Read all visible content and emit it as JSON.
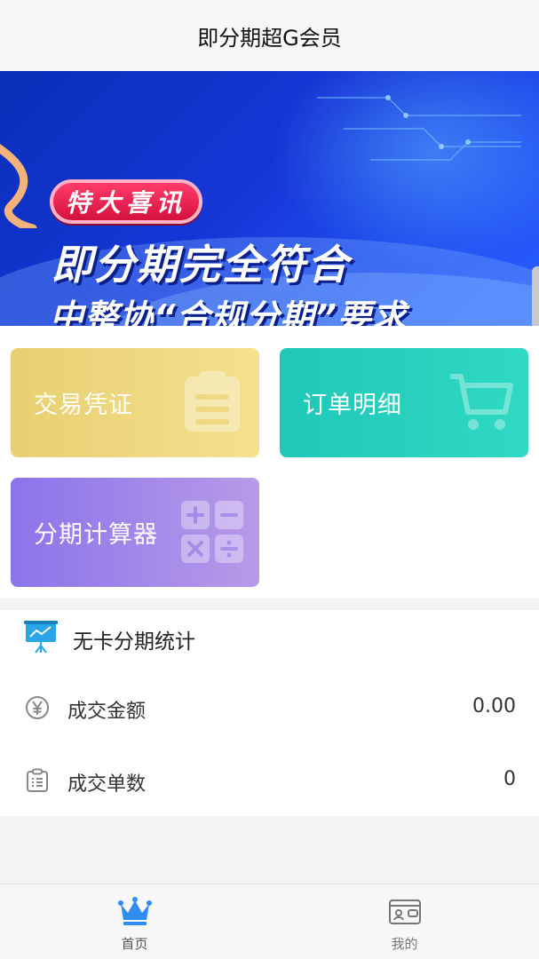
{
  "header": {
    "title": "即分期超G会员"
  },
  "banner": {
    "badge": "特大喜讯",
    "line1": "即分期完全符合",
    "line2": "中整协“合规分期”要求"
  },
  "tiles": [
    {
      "label": "交易凭证",
      "icon": "clipboard-icon",
      "color": "#e8cf72"
    },
    {
      "label": "订单明细",
      "icon": "cart-icon",
      "color": "#1fc8b8"
    },
    {
      "label": "分期计算器",
      "icon": "calculator-icon",
      "color": "#8a74ea"
    }
  ],
  "stats": {
    "title": "无卡分期统计",
    "title_icon": "presentation-chart-icon",
    "rows": [
      {
        "label": "成交金额",
        "value": "0.00",
        "icon": "yen-icon"
      },
      {
        "label": "成交单数",
        "value": "0",
        "icon": "list-icon"
      }
    ]
  },
  "tabbar": {
    "tabs": [
      {
        "label": "首页",
        "icon": "crown-icon",
        "active": true,
        "active_color": "#2f8cf0"
      },
      {
        "label": "我的",
        "icon": "wallet-icon",
        "active": false
      }
    ]
  }
}
